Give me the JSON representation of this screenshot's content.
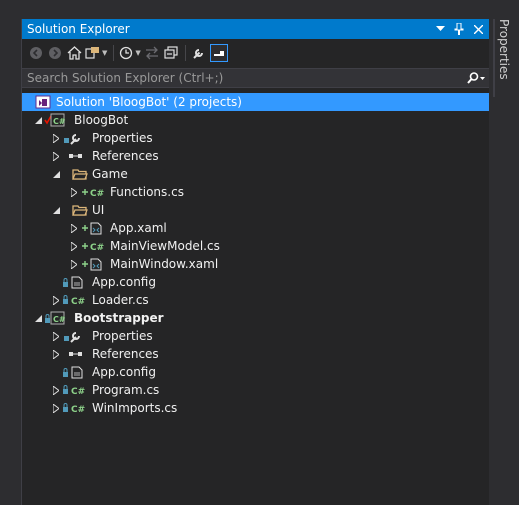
{
  "panel": {
    "title": "Solution Explorer",
    "colors": {
      "accent": "#007acc",
      "selection": "#3399ff",
      "background": "#252526"
    }
  },
  "side_tab": {
    "label": "Properties"
  },
  "search": {
    "placeholder": "Search Solution Explorer (Ctrl+;)"
  },
  "tree": {
    "solution": "Solution 'BloogBot' (2 projects)",
    "bloogbot": {
      "name": "BloogBot",
      "properties": "Properties",
      "references": "References",
      "game_folder": "Game",
      "functions": "Functions.cs",
      "ui_folder": "UI",
      "app_xaml": "App.xaml",
      "main_view_model": "MainViewModel.cs",
      "main_window": "MainWindow.xaml",
      "app_config": "App.config",
      "loader": "Loader.cs"
    },
    "bootstrapper": {
      "name": "Bootstrapper",
      "properties": "Properties",
      "references": "References",
      "app_config": "App.config",
      "program": "Program.cs",
      "winimports": "WinImports.cs"
    }
  }
}
